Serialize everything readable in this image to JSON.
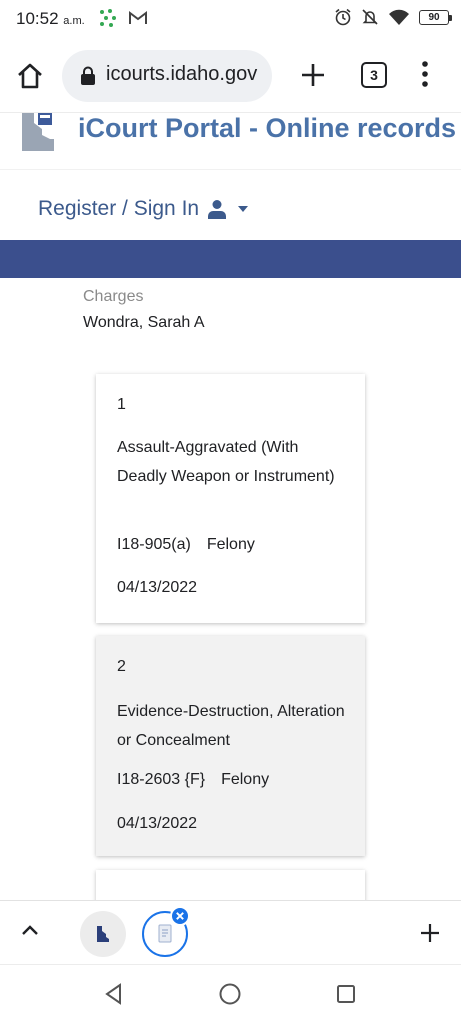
{
  "status_bar": {
    "time": "10:52",
    "ampm": "a.m.",
    "battery": "90",
    "left_icons": [
      "app-dots-icon",
      "gmail-icon"
    ],
    "right_icons": [
      "alarm-icon",
      "mute-icon",
      "wifi-icon",
      "battery-icon"
    ]
  },
  "browser": {
    "url": "icourts.idaho.gov",
    "tab_count": "3"
  },
  "header": {
    "title": "iCourt Portal - Online records",
    "signin": "Register / Sign In"
  },
  "content": {
    "section_label": "Charges",
    "defendant": "Wondra, Sarah A",
    "charges": [
      {
        "number": "1",
        "description": "Assault-Aggravated (With Deadly Weapon or Instrument)",
        "statute": "I18-905(a)",
        "severity": "Felony",
        "date": "04/13/2022"
      },
      {
        "number": "2",
        "description": "Evidence-Destruction, Alteration or Concealment",
        "statute": "I18-2603 {F}",
        "severity": "Felony",
        "date": "04/13/2022"
      }
    ]
  },
  "colors": {
    "title_blue": "#4a72a8",
    "nav_band": "#3b4f8d",
    "tab_accent": "#1a73e8"
  }
}
